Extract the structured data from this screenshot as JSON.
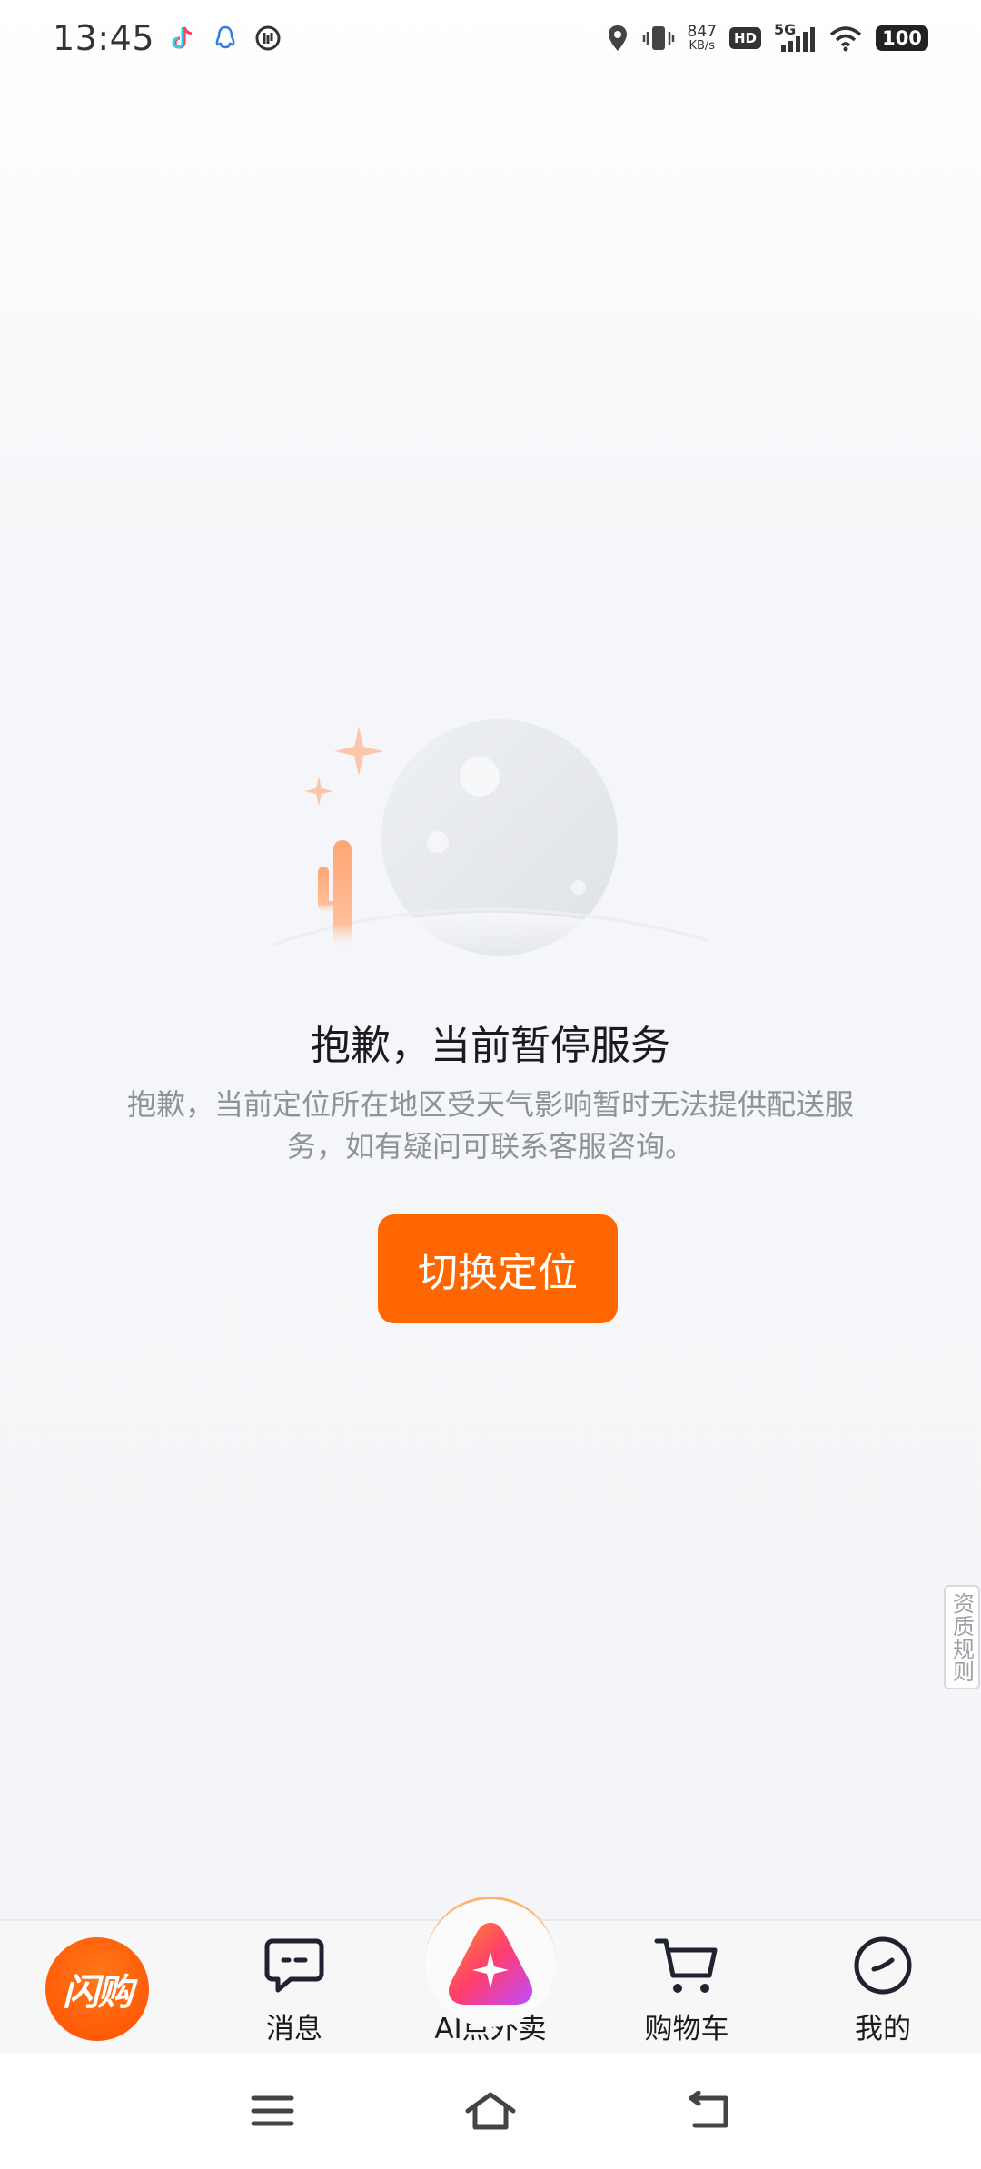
{
  "status_bar": {
    "time": "13:45",
    "app_icons": [
      "tiktok-icon",
      "qq-icon",
      "speed-icon"
    ],
    "net_speed_value": "847",
    "net_speed_unit": "KB/s",
    "hd_label": "HD",
    "network_label": "5G",
    "battery": "100"
  },
  "empty_state": {
    "illustration": "cactus-moon-illustration",
    "title": "抱歉，当前暂停服务",
    "description": "抱歉，当前定位所在地区受天气影响暂时无法提供配送服务，如有疑问可联系客服咨询。",
    "action_button": "切换定位"
  },
  "side_tab": {
    "label": "资质规则"
  },
  "tab_bar": {
    "logo_text": "闪购",
    "items": [
      {
        "label": "消息",
        "icon": "message-icon"
      },
      {
        "label": "AI点外卖",
        "icon": "ai-star-icon"
      },
      {
        "label": "购物车",
        "icon": "cart-icon"
      },
      {
        "label": "我的",
        "icon": "profile-icon"
      }
    ]
  },
  "nav_bar": {
    "buttons": [
      "menu-icon",
      "home-icon",
      "back-icon"
    ]
  },
  "colors": {
    "accent": "#ff6600",
    "text_primary": "#1b1b1f",
    "text_secondary": "#8f9299"
  }
}
